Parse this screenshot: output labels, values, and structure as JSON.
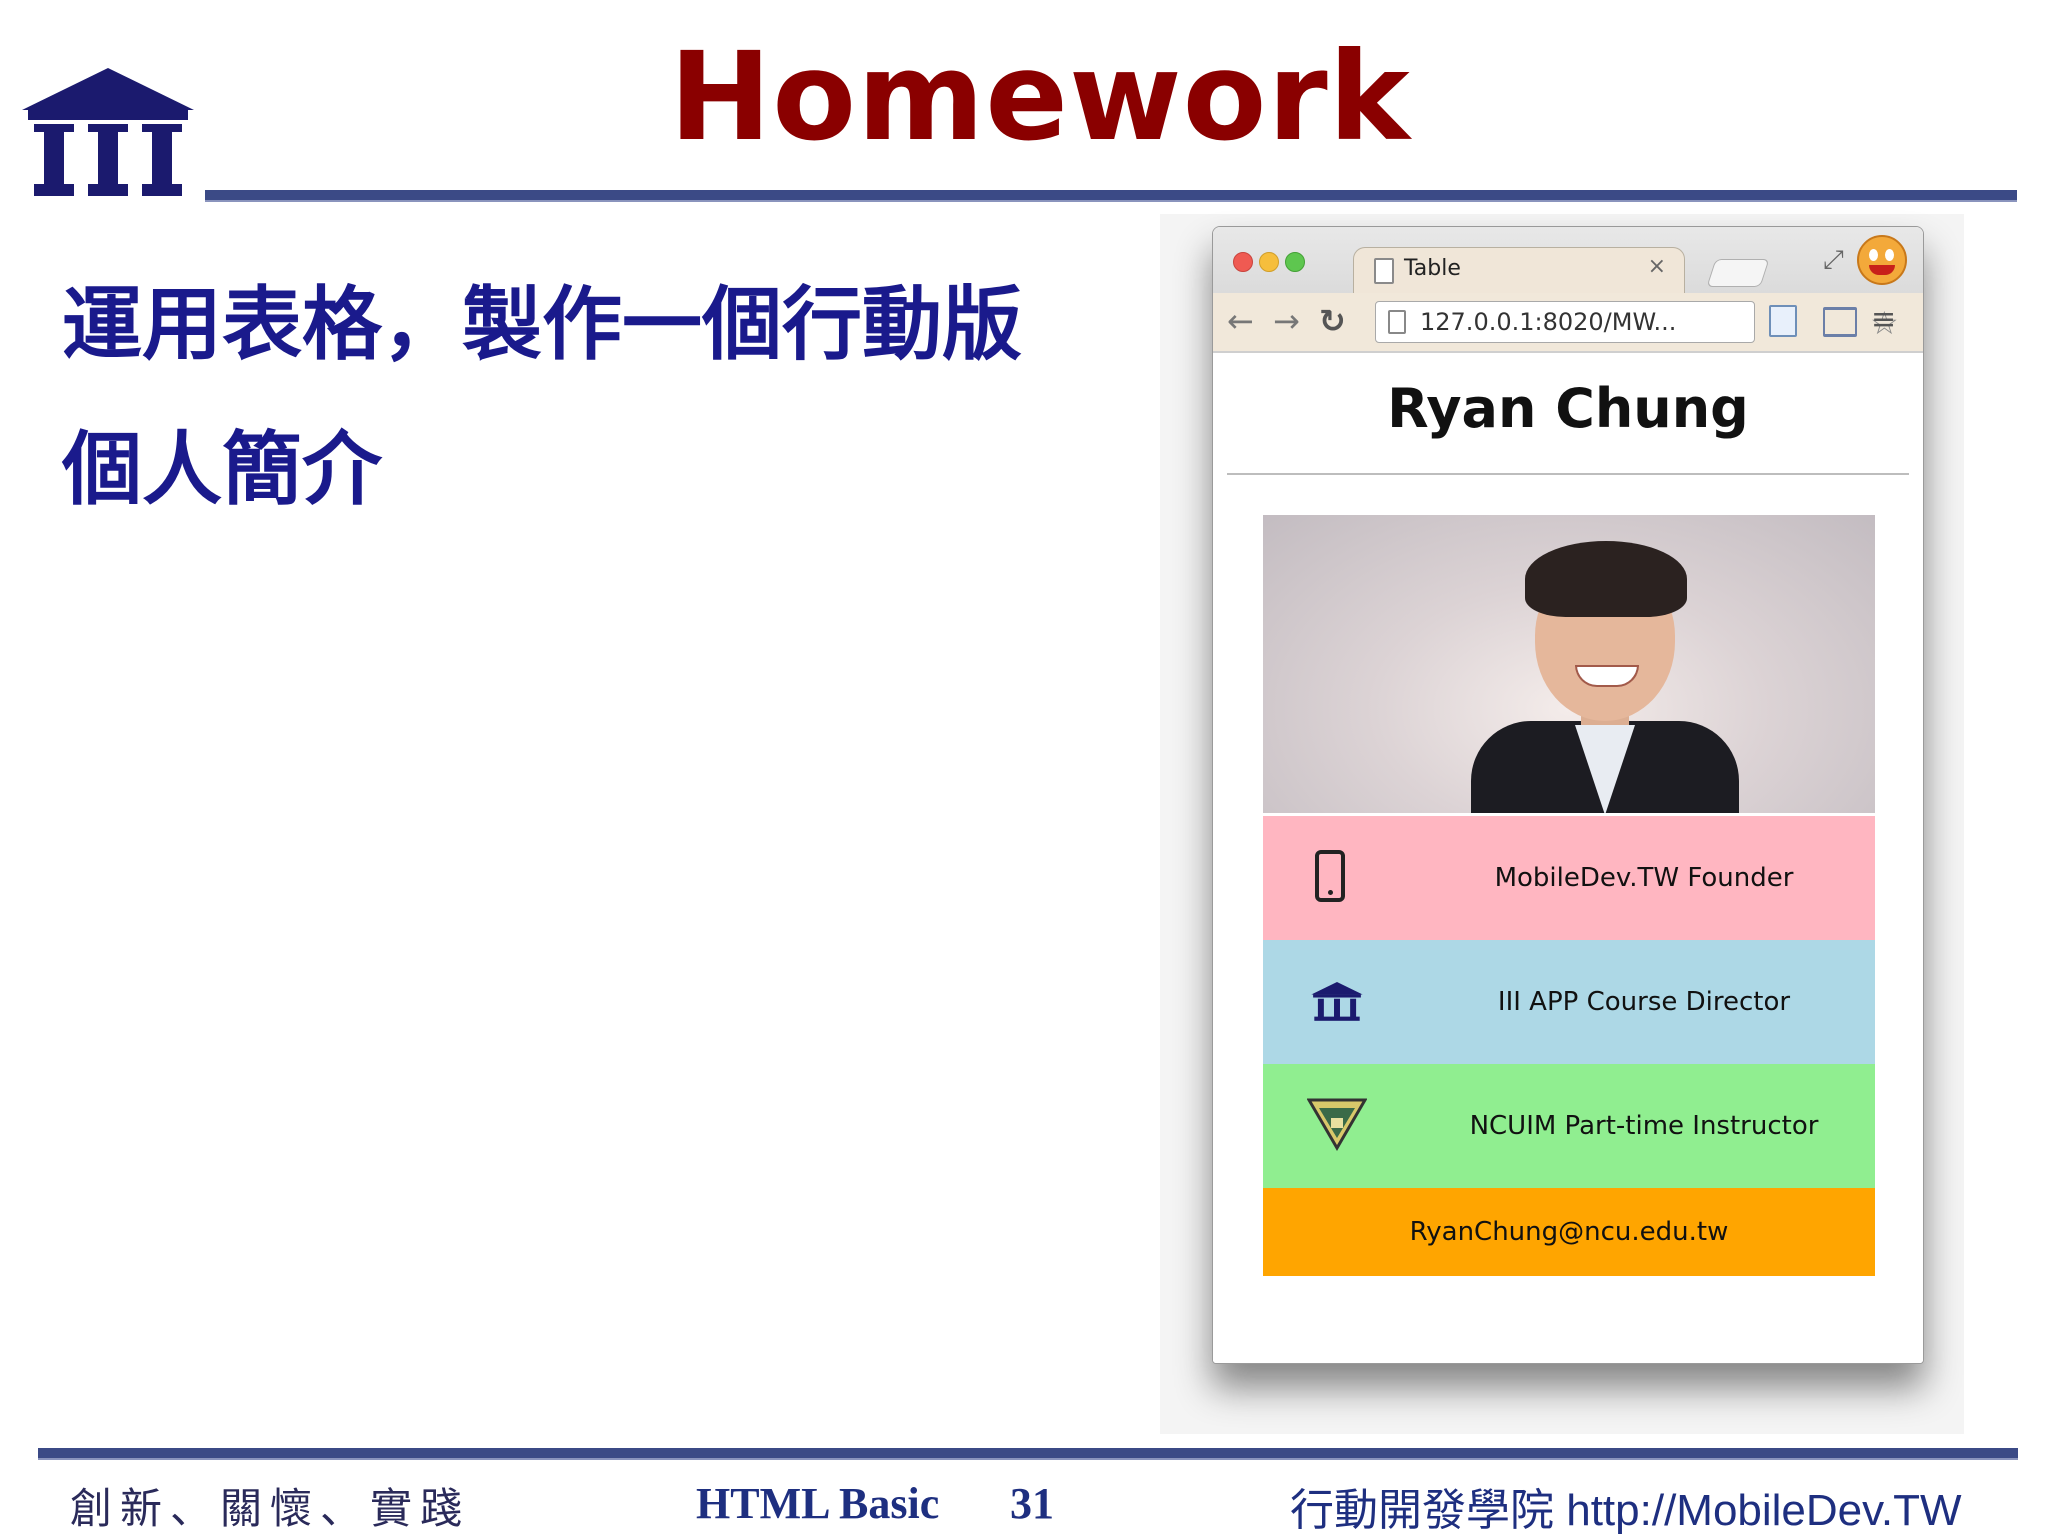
{
  "header": {
    "title": "Homework"
  },
  "body": {
    "lines": [
      "運用表格，製作一個行動版",
      "個人簡介"
    ]
  },
  "browser": {
    "tab_label": "Table",
    "tab_close": "×",
    "url": "127.0.0.1:8020/MW...",
    "page_heading": "Ryan Chung",
    "rows": [
      {
        "text": "MobileDev.TW Founder",
        "color": "#ffb6c1",
        "icon": "phone-icon"
      },
      {
        "text": "III APP Course Director",
        "color": "#add8e6",
        "icon": "institute-icon"
      },
      {
        "text": "NCUIM Part-time Instructor",
        "color": "#90ee90",
        "icon": "school-badge-icon"
      },
      {
        "text": "RyanChung@ncu.edu.tw",
        "color": "#ffa500",
        "icon": ""
      }
    ]
  },
  "footer": {
    "motto": "創新、關懷、實踐",
    "course": "HTML Basic",
    "page": "31",
    "academy": "行動開發學院 http://MobileDev.TW"
  },
  "colors": {
    "title": "#8a0000",
    "body": "#1a1a8c",
    "rule": "#3b4a86",
    "footer": "#1e2f80"
  }
}
